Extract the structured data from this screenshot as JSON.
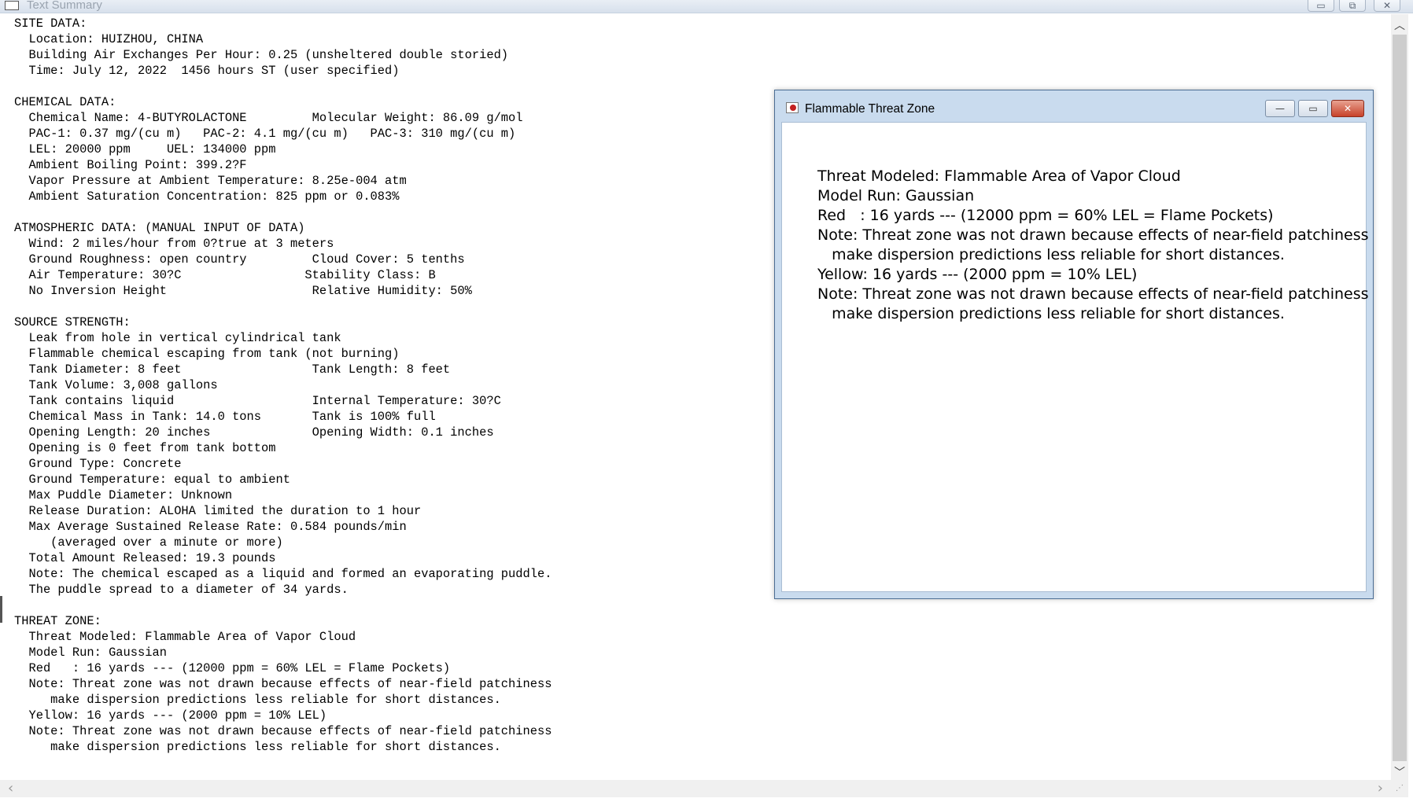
{
  "main_window": {
    "title": "Text Summary",
    "buttons": {
      "minimize": "▭",
      "maximize": "⧉",
      "close": "✕"
    }
  },
  "summary_text": "SITE DATA:\n  Location: HUIZHOU, CHINA\n  Building Air Exchanges Per Hour: 0.25 (unsheltered double storied)\n  Time: July 12, 2022  1456 hours ST (user specified)\n\nCHEMICAL DATA:\n  Chemical Name: 4-BUTYROLACTONE         Molecular Weight: 86.09 g/mol\n  PAC-1: 0.37 mg/(cu m)   PAC-2: 4.1 mg/(cu m)   PAC-3: 310 mg/(cu m)\n  LEL: 20000 ppm     UEL: 134000 ppm\n  Ambient Boiling Point: 399.2?F\n  Vapor Pressure at Ambient Temperature: 8.25e-004 atm\n  Ambient Saturation Concentration: 825 ppm or 0.083%\n\nATMOSPHERIC DATA: (MANUAL INPUT OF DATA)\n  Wind: 2 miles/hour from 0?true at 3 meters\n  Ground Roughness: open country         Cloud Cover: 5 tenths\n  Air Temperature: 30?C                 Stability Class: B\n  No Inversion Height                    Relative Humidity: 50%\n\nSOURCE STRENGTH:\n  Leak from hole in vertical cylindrical tank\n  Flammable chemical escaping from tank (not burning)\n  Tank Diameter: 8 feet                  Tank Length: 8 feet\n  Tank Volume: 3,008 gallons\n  Tank contains liquid                   Internal Temperature: 30?C\n  Chemical Mass in Tank: 14.0 tons       Tank is 100% full\n  Opening Length: 20 inches              Opening Width: 0.1 inches\n  Opening is 0 feet from tank bottom\n  Ground Type: Concrete\n  Ground Temperature: equal to ambient\n  Max Puddle Diameter: Unknown\n  Release Duration: ALOHA limited the duration to 1 hour\n  Max Average Sustained Release Rate: 0.584 pounds/min\n     (averaged over a minute or more)\n  Total Amount Released: 19.3 pounds\n  Note: The chemical escaped as a liquid and formed an evaporating puddle.\n  The puddle spread to a diameter of 34 yards.\n\nTHREAT ZONE:\n  Threat Modeled: Flammable Area of Vapor Cloud\n  Model Run: Gaussian\n  Red   : 16 yards --- (12000 ppm = 60% LEL = Flame Pockets)\n  Note: Threat zone was not drawn because effects of near-field patchiness\n     make dispersion predictions less reliable for short distances.\n  Yellow: 16 yards --- (2000 ppm = 10% LEL)\n  Note: Threat zone was not drawn because effects of near-field patchiness\n     make dispersion predictions less reliable for short distances.",
  "threat_window": {
    "title": "Flammable Threat Zone",
    "buttons": {
      "minimize": "—",
      "maximize": "▭",
      "close": "✕"
    },
    "text": "Threat Modeled: Flammable Area of Vapor Cloud\nModel Run: Gaussian\nRed   : 16 yards --- (12000 ppm = 60% LEL = Flame Pockets)\nNote: Threat zone was not drawn because effects of near-field patchiness\n   make dispersion predictions less reliable for short distances.\nYellow: 16 yards --- (2000 ppm = 10% LEL)\nNote: Threat zone was not drawn because effects of near-field patchiness\n   make dispersion predictions less reliable for short distances."
  },
  "scrollbars": {
    "up": "︿",
    "down": "﹀",
    "left": "‹",
    "right": "›"
  }
}
